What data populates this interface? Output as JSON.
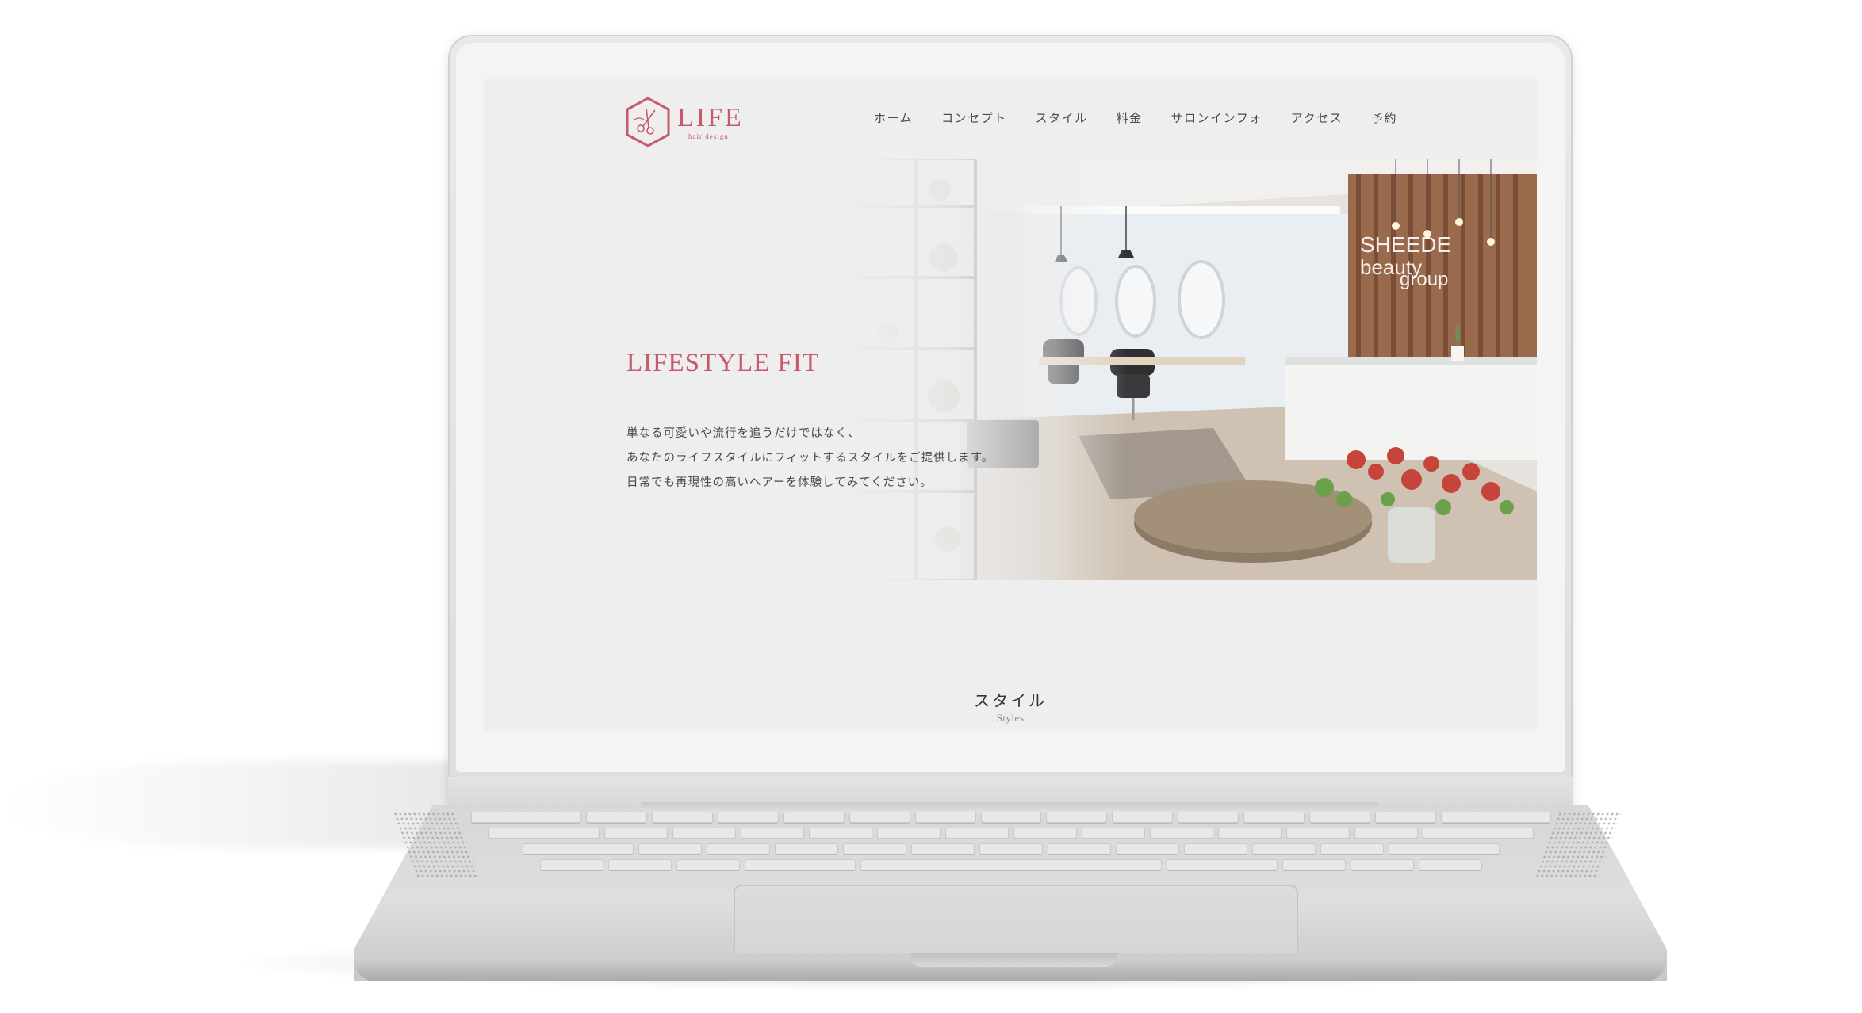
{
  "site": {
    "logo": {
      "title": "LIFE",
      "subtitle": "hair design",
      "color": "#c8596a",
      "icon": "scissors-hexagon-logo"
    },
    "nav": [
      {
        "label": "ホーム"
      },
      {
        "label": "コンセプト"
      },
      {
        "label": "スタイル"
      },
      {
        "label": "料金"
      },
      {
        "label": "サロンインフォ"
      },
      {
        "label": "アクセス"
      },
      {
        "label": "予約"
      }
    ],
    "hero": {
      "title": "LIFESTYLE FIT",
      "lines": [
        "単なる可愛いや流行を追うだけではなく、",
        "あなたのライフスタイルにフィットするスタイルをご提供します。",
        "日常でも再現性の高いヘアーを体験してみてください。"
      ],
      "photo_sign": [
        "SHEEDE",
        "beauty",
        "group"
      ]
    },
    "section": {
      "title": "スタイル",
      "subtitle": "Styles"
    }
  },
  "colors": {
    "accent": "#c8596a",
    "screen_bg": "#eeeeef",
    "body_text": "#4a4a4a"
  }
}
